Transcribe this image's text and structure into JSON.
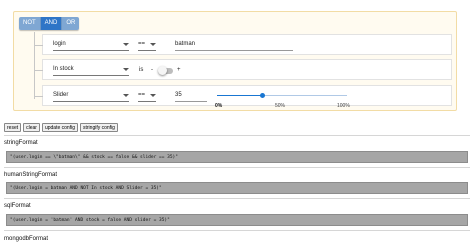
{
  "conjunctions": [
    {
      "label": "NOT",
      "active": false
    },
    {
      "label": "AND",
      "active": true
    },
    {
      "label": "OR",
      "active": false
    }
  ],
  "rules": [
    {
      "field": "login",
      "operator": "==",
      "value": "batman"
    },
    {
      "field": "In stock",
      "operator": "is",
      "toggle_left": "-",
      "toggle_right": "+"
    },
    {
      "field": "Slider",
      "operator": "==",
      "value": "35",
      "slider_value": 35,
      "ticks": [
        "0%",
        "50%",
        "100%"
      ]
    }
  ],
  "actions": [
    "reset",
    "clear",
    "update config",
    "stringify config"
  ],
  "outputs": [
    {
      "title": "stringFormat",
      "code": "\"(user.login == \\\"batman\\\" && stock == false && slider == 35)\""
    },
    {
      "title": "humanStringFormat",
      "code": "\"(User.login = batman AND NOT In stock AND Slider = 35)\""
    },
    {
      "title": "sqlFormat",
      "code": "\"(user.login = 'batman' AND stock = false AND slider = 35)\""
    },
    {
      "title": "mongodbFormat",
      "code": ""
    }
  ],
  "colors": {
    "accent": "#2e75c7",
    "group_bg": "#fffbf0",
    "code_bg": "#a6a6a6"
  }
}
